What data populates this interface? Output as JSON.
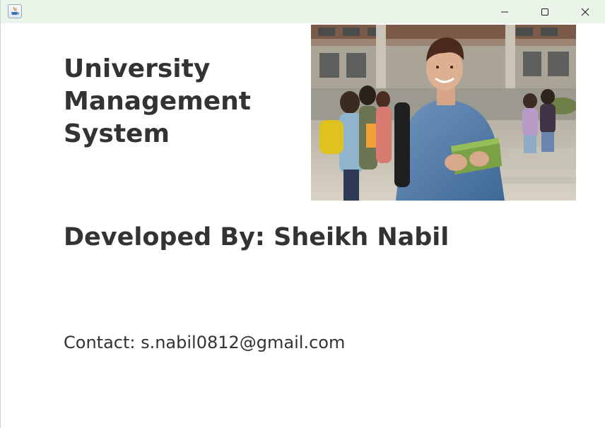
{
  "window": {
    "app_icon": "java-cup-icon",
    "controls": {
      "minimize_icon": "minimize-icon",
      "maximize_icon": "maximize-icon",
      "close_icon": "close-icon"
    },
    "titlebar_color": "#eaf4e9"
  },
  "about": {
    "title_lines": [
      "University",
      "Management",
      "System"
    ],
    "developer": "Developed By: Sheikh Nabil",
    "contact": "Contact: s.nabil0812@gmail.com"
  },
  "colors": {
    "text": "#333333",
    "background": "#ffffff"
  }
}
